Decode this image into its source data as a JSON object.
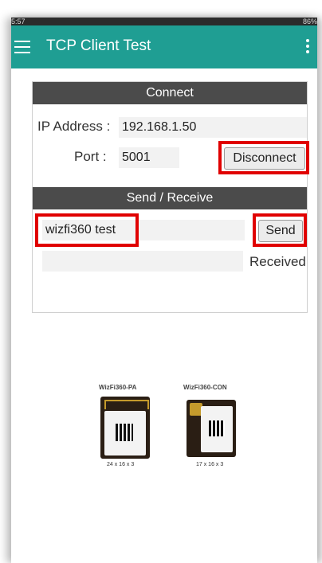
{
  "status_bar": {
    "left": "5:57",
    "right": "86%"
  },
  "app_bar": {
    "title": "TCP Client Test"
  },
  "connect": {
    "header": "Connect",
    "ip_label": "IP Address :",
    "ip_value": "192.168.1.50",
    "port_label": "Port :",
    "port_value": "5001",
    "disconnect_label": "Disconnect"
  },
  "send_receive": {
    "header": "Send / Receive",
    "message_value": "wizfi360 test",
    "send_label": "Send",
    "received_value": "",
    "received_label": "Received"
  },
  "modules": [
    {
      "name": "WizFi360-PA",
      "dims": "24 x 16 x 3"
    },
    {
      "name": "WizFi360-CON",
      "dims": "17 x 16 x 3"
    }
  ],
  "colors": {
    "app_bar": "#1f9e93",
    "section_header": "#4b4b4b",
    "highlight": "#e00000"
  },
  "icons": [
    "menu-icon",
    "overflow-menu-icon"
  ]
}
